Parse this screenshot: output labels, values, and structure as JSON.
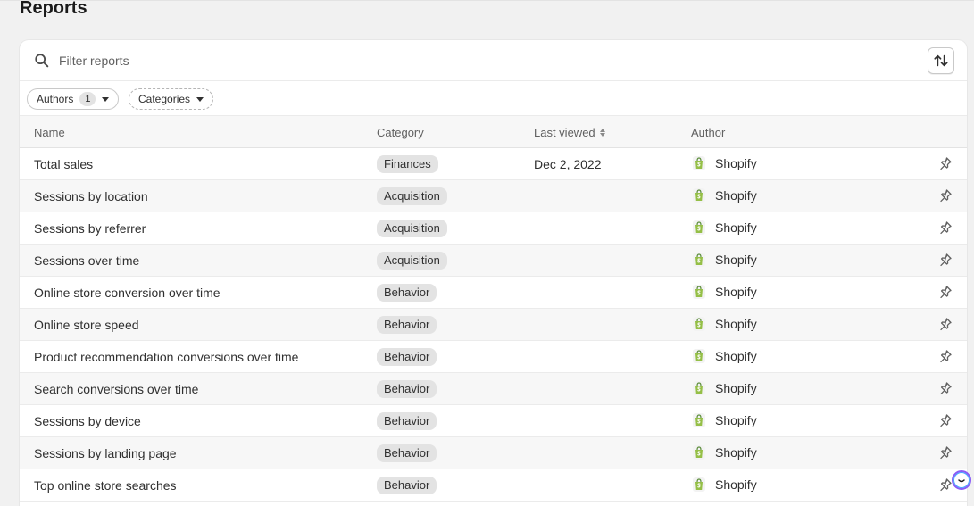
{
  "page": {
    "title": "Reports"
  },
  "search": {
    "placeholder": "Filter reports"
  },
  "filters": {
    "authors_label": "Authors",
    "authors_count": "1",
    "categories_label": "Categories"
  },
  "table": {
    "headers": {
      "name": "Name",
      "category": "Category",
      "last_viewed": "Last viewed",
      "author": "Author"
    },
    "rows": [
      {
        "name": "Total sales",
        "category": "Finances",
        "last_viewed": "Dec 2, 2022",
        "author": "Shopify"
      },
      {
        "name": "Sessions by location",
        "category": "Acquisition",
        "last_viewed": "",
        "author": "Shopify"
      },
      {
        "name": "Sessions by referrer",
        "category": "Acquisition",
        "last_viewed": "",
        "author": "Shopify"
      },
      {
        "name": "Sessions over time",
        "category": "Acquisition",
        "last_viewed": "",
        "author": "Shopify"
      },
      {
        "name": "Online store conversion over time",
        "category": "Behavior",
        "last_viewed": "",
        "author": "Shopify"
      },
      {
        "name": "Online store speed",
        "category": "Behavior",
        "last_viewed": "",
        "author": "Shopify"
      },
      {
        "name": "Product recommendation conversions over time",
        "category": "Behavior",
        "last_viewed": "",
        "author": "Shopify"
      },
      {
        "name": "Search conversions over time",
        "category": "Behavior",
        "last_viewed": "",
        "author": "Shopify"
      },
      {
        "name": "Sessions by device",
        "category": "Behavior",
        "last_viewed": "",
        "author": "Shopify"
      },
      {
        "name": "Sessions by landing page",
        "category": "Behavior",
        "last_viewed": "",
        "author": "Shopify"
      },
      {
        "name": "Top online store searches",
        "category": "Behavior",
        "last_viewed": "",
        "author": "Shopify"
      }
    ]
  },
  "icons": {
    "search": "search-icon",
    "sort": "sort-arrows-icon",
    "author_logo": "shopify-bag-icon",
    "pin": "pin-icon"
  },
  "colors": {
    "shopify_green": "#95bf47",
    "background": "#f1f1f1",
    "badge": "#e3e3e3"
  }
}
